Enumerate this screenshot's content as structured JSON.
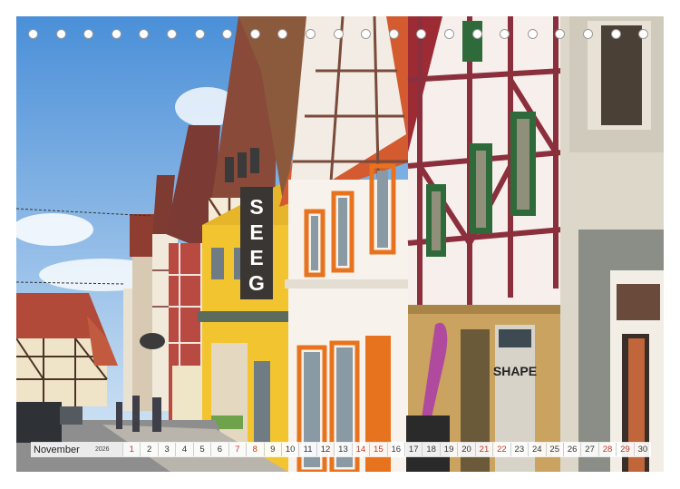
{
  "calendar": {
    "month": "November",
    "year": "2026",
    "days": [
      {
        "n": "1",
        "weekend": true
      },
      {
        "n": "2",
        "weekend": false
      },
      {
        "n": "3",
        "weekend": false
      },
      {
        "n": "4",
        "weekend": false
      },
      {
        "n": "5",
        "weekend": false
      },
      {
        "n": "6",
        "weekend": false
      },
      {
        "n": "7",
        "weekend": true
      },
      {
        "n": "8",
        "weekend": true
      },
      {
        "n": "9",
        "weekend": false
      },
      {
        "n": "10",
        "weekend": false
      },
      {
        "n": "11",
        "weekend": false
      },
      {
        "n": "12",
        "weekend": false
      },
      {
        "n": "13",
        "weekend": false
      },
      {
        "n": "14",
        "weekend": true
      },
      {
        "n": "15",
        "weekend": true
      },
      {
        "n": "16",
        "weekend": false
      },
      {
        "n": "17",
        "weekend": false
      },
      {
        "n": "18",
        "weekend": false
      },
      {
        "n": "19",
        "weekend": false
      },
      {
        "n": "20",
        "weekend": false
      },
      {
        "n": "21",
        "weekend": true
      },
      {
        "n": "22",
        "weekend": true
      },
      {
        "n": "23",
        "weekend": false
      },
      {
        "n": "24",
        "weekend": false
      },
      {
        "n": "25",
        "weekend": false
      },
      {
        "n": "26",
        "weekend": false
      },
      {
        "n": "27",
        "weekend": false
      },
      {
        "n": "28",
        "weekend": true
      },
      {
        "n": "29",
        "weekend": true
      },
      {
        "n": "30",
        "weekend": false
      }
    ]
  },
  "signs": {
    "seeg": "SEEG",
    "shape": "SHAPE"
  },
  "colors": {
    "sky_top": "#4a90d9",
    "sky_bottom": "#cfe3f5",
    "yellow_facade": "#f2c530",
    "orange_trim": "#e8731f",
    "timber_red": "#8c2f3c",
    "sandstone": "#c9a35f",
    "weekend_red": "#c0392b"
  },
  "binding": {
    "ring_count": 23
  }
}
